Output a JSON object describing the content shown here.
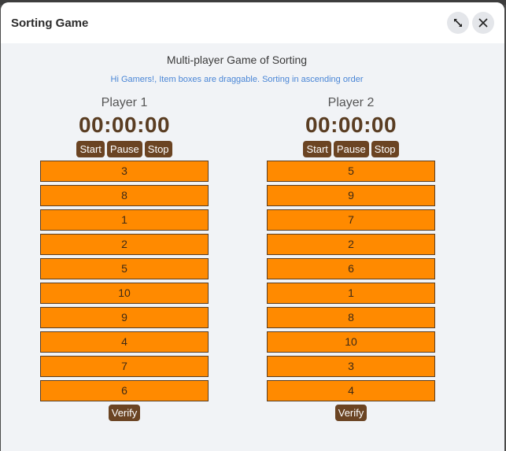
{
  "dialog": {
    "title": "Sorting Game"
  },
  "game": {
    "title": "Multi-player Game of Sorting",
    "hint": "Hi Gamers!, Item boxes are draggable. Sorting in ascending order"
  },
  "players": [
    {
      "name": "Player 1",
      "timer": "00:00:00",
      "start": "Start",
      "pause": "Pause",
      "stop": "Stop",
      "items": [
        "3",
        "8",
        "1",
        "2",
        "5",
        "10",
        "9",
        "4",
        "7",
        "6"
      ],
      "verify": "Verify"
    },
    {
      "name": "Player 2",
      "timer": "00:00:00",
      "start": "Start",
      "pause": "Pause",
      "stop": "Stop",
      "items": [
        "5",
        "9",
        "7",
        "2",
        "6",
        "1",
        "8",
        "10",
        "3",
        "4"
      ],
      "verify": "Verify"
    }
  ],
  "icons": {
    "expand": "expand-icon",
    "close": "close-icon"
  },
  "colors": {
    "item_fill": "#ff8a00",
    "button": "#6b4423",
    "timer": "#5a3d22",
    "hint": "#4a86d6"
  }
}
